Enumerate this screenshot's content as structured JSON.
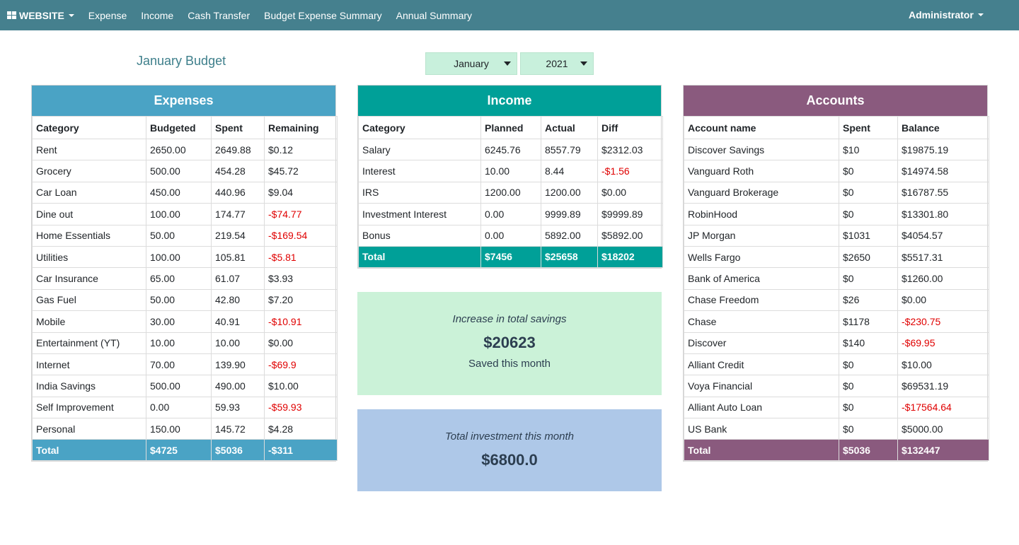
{
  "navbar": {
    "brand": "WEBSITE",
    "links": [
      "Expense",
      "Income",
      "Cash Transfer",
      "Budget Expense Summary",
      "Annual Summary"
    ],
    "user": "Administrator"
  },
  "page_title": "January Budget",
  "filters": {
    "month": "January",
    "year": "2021"
  },
  "expenses": {
    "title": "Expenses",
    "columns": [
      "Category",
      "Budgeted",
      "Spent",
      "Remaining"
    ],
    "rows": [
      [
        "Rent",
        "2650.00",
        "2649.88",
        "$0.12"
      ],
      [
        "Grocery",
        "500.00",
        "454.28",
        "$45.72"
      ],
      [
        "Car Loan",
        "450.00",
        "440.96",
        "$9.04"
      ],
      [
        "Dine out",
        "100.00",
        "174.77",
        "-$74.77"
      ],
      [
        "Home Essentials",
        "50.00",
        "219.54",
        "-$169.54"
      ],
      [
        "Utilities",
        "100.00",
        "105.81",
        "-$5.81"
      ],
      [
        "Car Insurance",
        "65.00",
        "61.07",
        "$3.93"
      ],
      [
        "Gas Fuel",
        "50.00",
        "42.80",
        "$7.20"
      ],
      [
        "Mobile",
        "30.00",
        "40.91",
        "-$10.91"
      ],
      [
        "Entertainment (YT)",
        "10.00",
        "10.00",
        "$0.00"
      ],
      [
        "Internet",
        "70.00",
        "139.90",
        "-$69.9"
      ],
      [
        "India Savings",
        "500.00",
        "490.00",
        "$10.00"
      ],
      [
        "Self Improvement",
        "0.00",
        "59.93",
        "-$59.93"
      ],
      [
        "Personal",
        "150.00",
        "145.72",
        "$4.28"
      ]
    ],
    "total": [
      "Total",
      "$4725",
      "$5036",
      "-$311"
    ]
  },
  "income": {
    "title": "Income",
    "columns": [
      "Category",
      "Planned",
      "Actual",
      "Diff"
    ],
    "rows": [
      [
        "Salary",
        "6245.76",
        "8557.79",
        "$2312.03"
      ],
      [
        "Interest",
        "10.00",
        "8.44",
        "-$1.56"
      ],
      [
        "IRS",
        "1200.00",
        "1200.00",
        "$0.00"
      ],
      [
        "Investment Interest",
        "0.00",
        "9999.89",
        "$9999.89"
      ],
      [
        "Bonus",
        "0.00",
        "5892.00",
        "$5892.00"
      ]
    ],
    "total": [
      "Total",
      "$7456",
      "$25658",
      "$18202"
    ]
  },
  "accounts": {
    "title": "Accounts",
    "columns": [
      "Account name",
      "Spent",
      "Balance"
    ],
    "rows": [
      [
        "Discover Savings",
        "$10",
        "$19875.19"
      ],
      [
        "Vanguard Roth",
        "$0",
        "$14974.58"
      ],
      [
        "Vanguard Brokerage",
        "$0",
        "$16787.55"
      ],
      [
        "RobinHood",
        "$0",
        "$13301.80"
      ],
      [
        "JP Morgan",
        "$1031",
        "$4054.57"
      ],
      [
        "Wells Fargo",
        "$2650",
        "$5517.31"
      ],
      [
        "Bank of America",
        "$0",
        "$1260.00"
      ],
      [
        "Chase Freedom",
        "$26",
        "$0.00"
      ],
      [
        "Chase",
        "$1178",
        "-$230.75"
      ],
      [
        "Discover",
        "$140",
        "-$69.95"
      ],
      [
        "Alliant Credit",
        "$0",
        "$10.00"
      ],
      [
        "Voya Financial",
        "$0",
        "$69531.19"
      ],
      [
        "Alliant Auto Loan",
        "$0",
        "-$17564.64"
      ],
      [
        "US Bank",
        "$0",
        "$5000.00"
      ]
    ],
    "total": [
      "Total",
      "$5036",
      "$132447"
    ]
  },
  "savings_card": {
    "label": "Increase in total savings",
    "value": "$20623",
    "sub": "Saved this month"
  },
  "investment_card": {
    "label": "Total investment this month",
    "value": "$6800.0"
  },
  "colors": {
    "navbar": "#45808e",
    "expenses": "#4aa3c5",
    "income": "#00a098",
    "accounts": "#8a5a7e",
    "negative": "#e00000",
    "savings_card": "#cbf2d8",
    "investment_card": "#aec8e8"
  },
  "icons": {
    "brand": "grid-icon",
    "dropdown": "caret-down-icon"
  }
}
